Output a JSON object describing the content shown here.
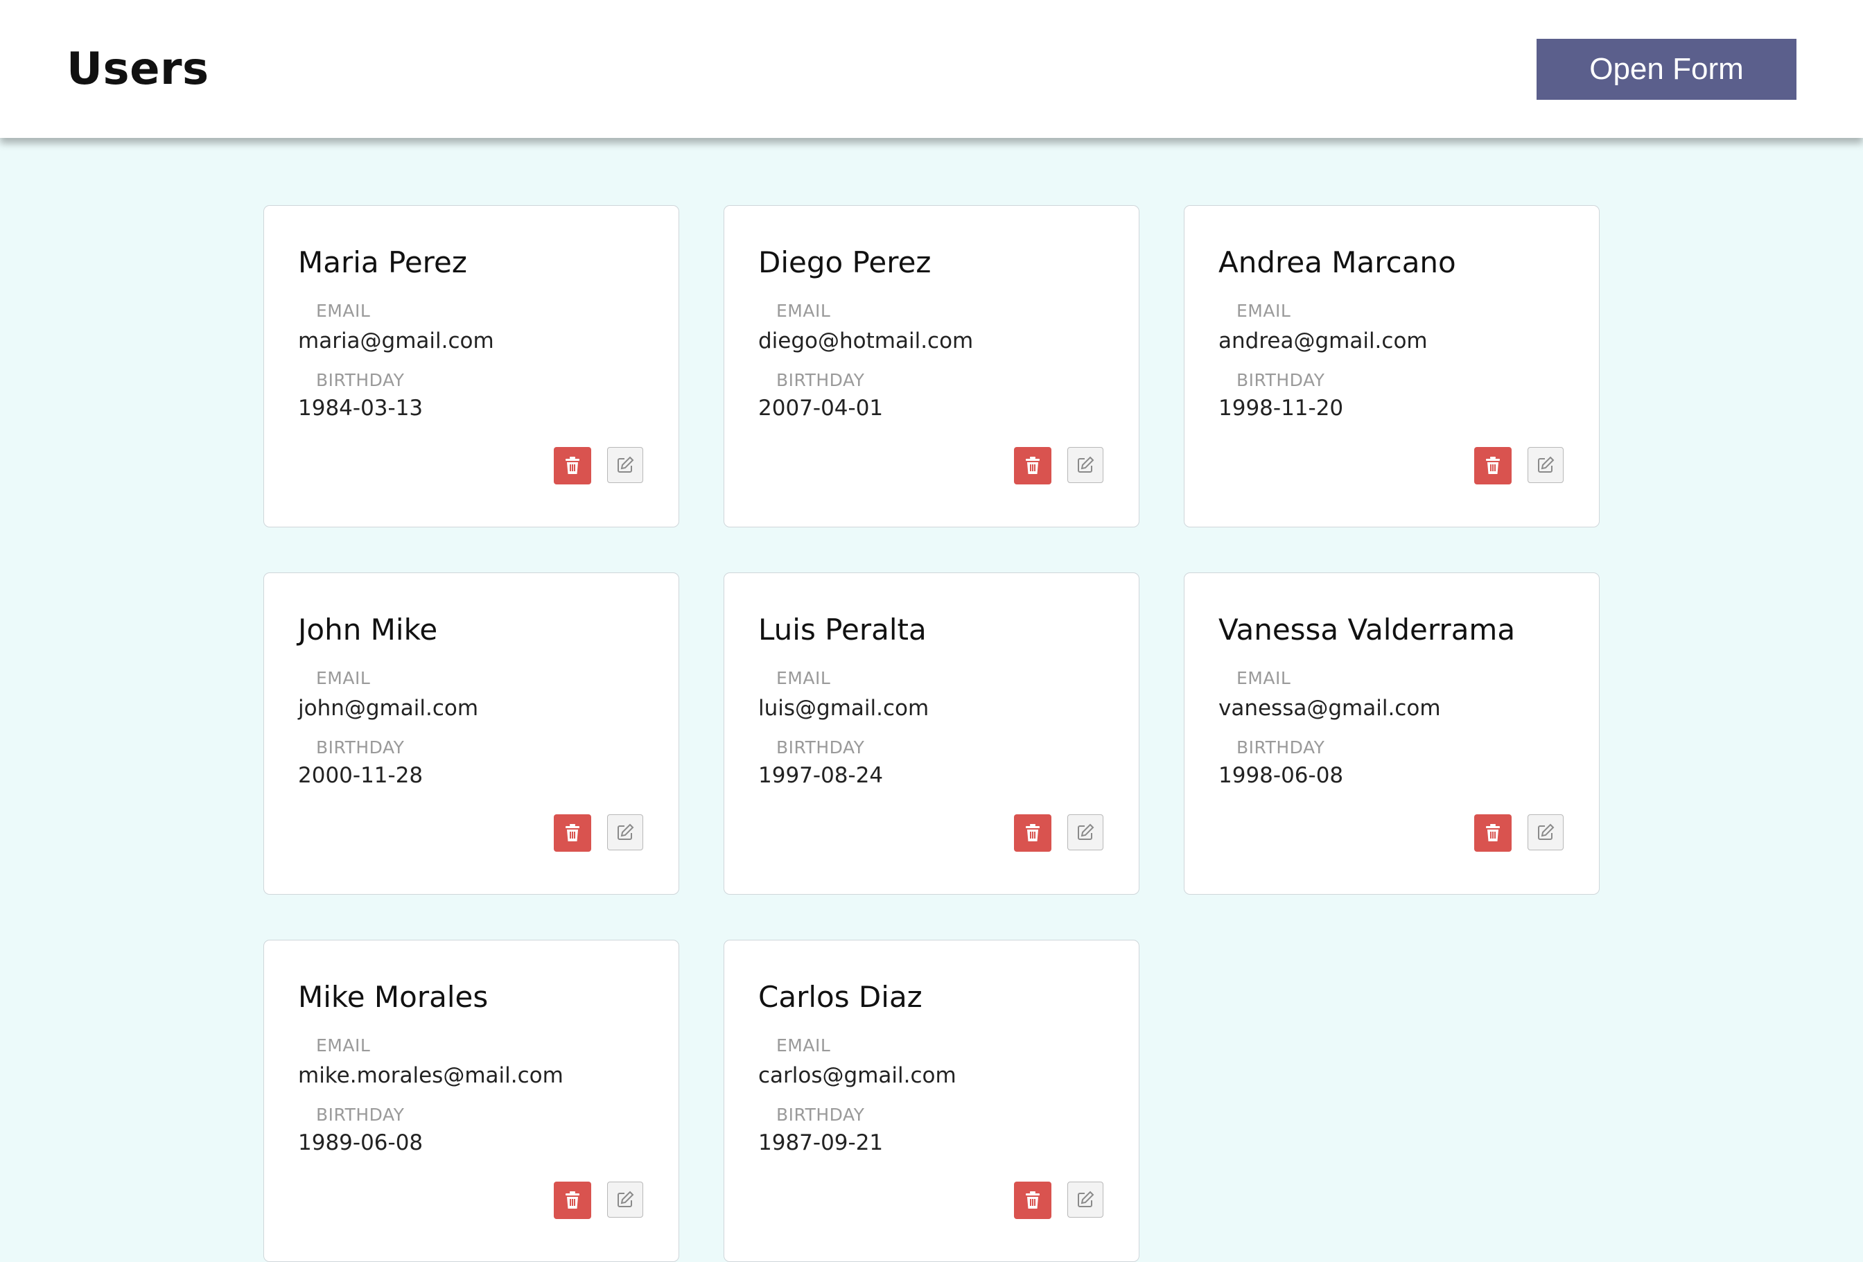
{
  "header": {
    "title": "Users",
    "open_form_label": "Open Form"
  },
  "labels": {
    "email": "EMAIL",
    "birthday": "BIRTHDAY"
  },
  "colors": {
    "page_background": "#ecfafa",
    "primary_button": "#5b5f8c",
    "delete_button": "#d9534f"
  },
  "icons": {
    "delete": "trash-icon",
    "edit": "edit-icon"
  },
  "users": [
    {
      "name": "Maria Perez",
      "email": "maria@gmail.com",
      "birthday": "1984-03-13"
    },
    {
      "name": "Diego Perez",
      "email": "diego@hotmail.com",
      "birthday": "2007-04-01"
    },
    {
      "name": "Andrea Marcano",
      "email": "andrea@gmail.com",
      "birthday": "1998-11-20"
    },
    {
      "name": "John Mike",
      "email": "john@gmail.com",
      "birthday": "2000-11-28"
    },
    {
      "name": "Luis Peralta",
      "email": "luis@gmail.com",
      "birthday": "1997-08-24"
    },
    {
      "name": "Vanessa Valderrama",
      "email": "vanessa@gmail.com",
      "birthday": "1998-06-08"
    },
    {
      "name": "Mike Morales",
      "email": "mike.morales@mail.com",
      "birthday": "1989-06-08"
    },
    {
      "name": "Carlos Diaz",
      "email": "carlos@gmail.com",
      "birthday": "1987-09-21"
    }
  ]
}
